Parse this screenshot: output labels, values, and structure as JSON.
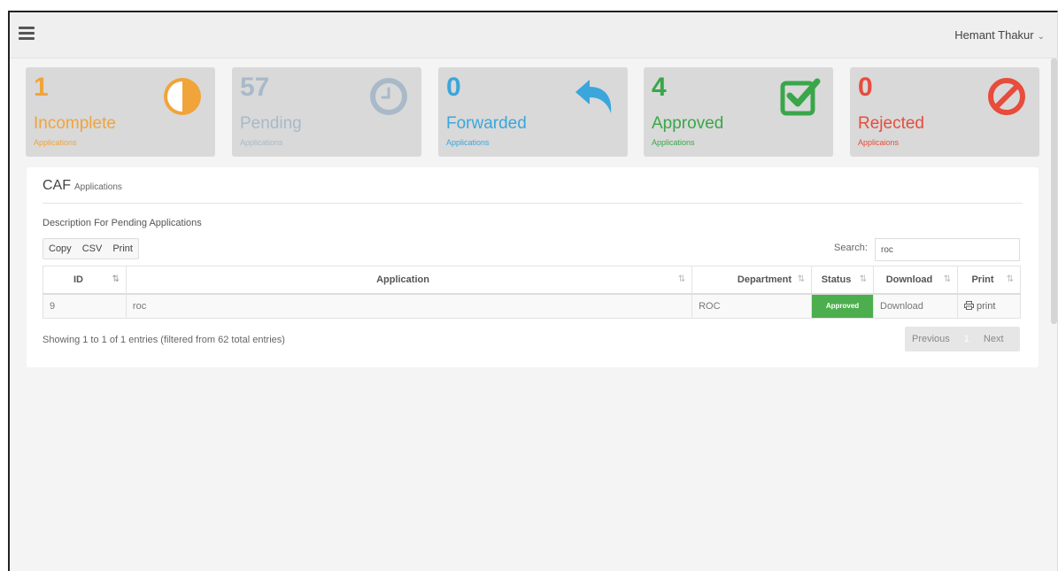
{
  "header": {
    "user_name": "Hemant Thakur",
    "chevron": "⌄"
  },
  "cards": [
    {
      "count": "1",
      "label": "Incomplete",
      "sub": "Applications",
      "color": "#f0a43a",
      "icon": "half-circle-icon"
    },
    {
      "count": "57",
      "label": "Pending",
      "sub": "Applications",
      "color": "#a9b9c8",
      "icon": "clock-icon"
    },
    {
      "count": "0",
      "label": "Forwarded",
      "sub": "Applications",
      "color": "#3ba6dc",
      "icon": "reply-arrow-icon"
    },
    {
      "count": "4",
      "label": "Approved",
      "sub": "Applications",
      "color": "#3aa64a",
      "icon": "check-square-icon"
    },
    {
      "count": "0",
      "label": "Rejected",
      "sub": "Applicaions",
      "color": "#e74c3c",
      "icon": "ban-icon"
    }
  ],
  "panel": {
    "title": "CAF",
    "title_small": "Applications",
    "description": "Description For Pending Applications",
    "buttons": {
      "copy": "Copy",
      "csv": "CSV",
      "print": "Print"
    },
    "search_label": "Search:",
    "search_value": "roc",
    "columns": {
      "id": "ID",
      "application": "Application",
      "department": "Department",
      "status": "Status",
      "download": "Download",
      "print": "Print"
    },
    "rows": [
      {
        "id": "9",
        "application": "roc",
        "department": "ROC",
        "status": "Approved",
        "download": "Download",
        "print": "print"
      }
    ],
    "showing": "Showing 1 to 1 of 1 entries (filtered from 62 total entries)",
    "pager": {
      "previous": "Previous",
      "page": "1",
      "next": "Next"
    }
  }
}
